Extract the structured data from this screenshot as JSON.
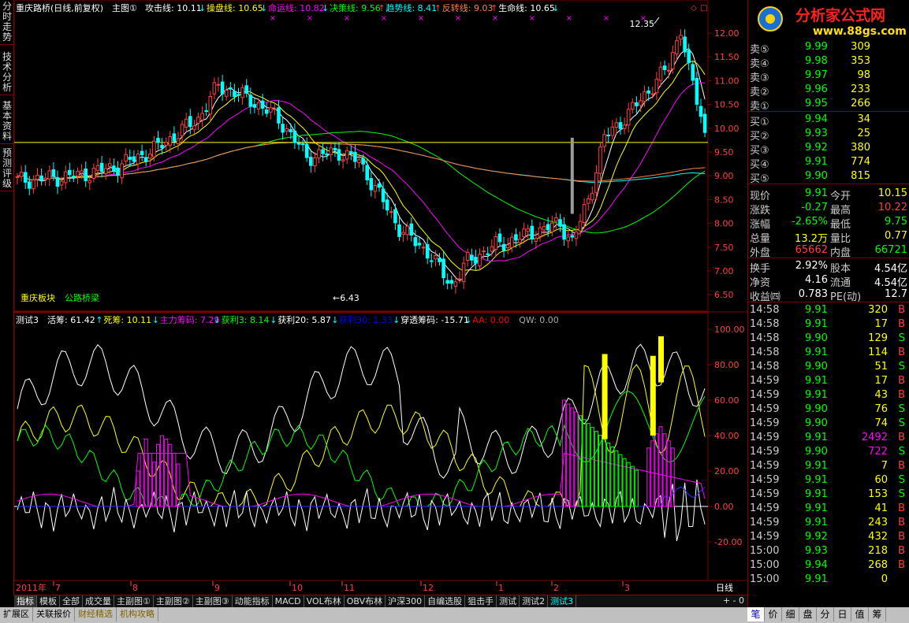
{
  "left_tabs": [
    "分时走势",
    "技术分析",
    "基本资料",
    "预测评级"
  ],
  "main_header": {
    "stock": "重庆路桥(日线,前复权)",
    "main_fig": "主图①",
    "lines": [
      {
        "label": "攻击线: 10.11",
        "arrow": "↓",
        "color": "#ffffff"
      },
      {
        "label": "操盘线: 10.65",
        "arrow": "↓",
        "color": "#ffff00"
      },
      {
        "label": "命运线: 10.82",
        "arrow": "↓",
        "color": "#ff00ff"
      },
      {
        "label": "决策线: 9.56",
        "arrow": "↑",
        "color": "#00ff00"
      },
      {
        "label": "趋势线: 8.41",
        "arrow": "↑",
        "color": "#00ffff"
      },
      {
        "label": "反转线: 9.03",
        "arrow": "↑",
        "color": "#ff8040"
      },
      {
        "label": "生命线: 10.65",
        "arrow": "↓",
        "color": "#ffffff"
      }
    ]
  },
  "main_annotations": {
    "high": "12.35",
    "low": "6.43",
    "sector": "重庆板块",
    "name": "公路桥梁"
  },
  "price_axis": [
    "12.00",
    "11.50",
    "11.00",
    "10.50",
    "10.00",
    "9.50",
    "9.00",
    "8.50",
    "8.00",
    "7.50",
    "7.00",
    "6.50"
  ],
  "ind_header": {
    "name": "测试3",
    "items": [
      {
        "label": "活筹: 61.42",
        "arrow": "↑",
        "color": "#ffffff"
      },
      {
        "label": "死筹: 10.11",
        "arrow": "↓",
        "color": "#ffff00"
      },
      {
        "label": "主力筹码: 7.29",
        "arrow": "↓",
        "color": "#ff00ff"
      },
      {
        "label": "获利3: 8.14",
        "arrow": "↓",
        "color": "#00ff00"
      },
      {
        "label": "获利20: 5.87",
        "arrow": "↓",
        "color": "#ffffff"
      },
      {
        "label": "获利30: 1.33",
        "arrow": "↓",
        "color": "#0000ff"
      },
      {
        "label": "穿透筹码: -15.71",
        "arrow": "↓",
        "color": "#ffffff"
      },
      {
        "label": "AA: 0.00",
        "arrow": "",
        "color": "#ff0000"
      },
      {
        "label": "QW: 0.00",
        "arrow": "",
        "color": "#aaaaaa"
      }
    ]
  },
  "ind_axis": [
    "100.00",
    "80.00",
    "60.00",
    "40.00",
    "20.00",
    "0.00",
    "-20.00"
  ],
  "date_axis": {
    "year": "2011年",
    "months": [
      "7",
      "8",
      "9",
      "10",
      "11",
      "12",
      "1",
      "2",
      "3"
    ],
    "period": "日线"
  },
  "bottom_tabs": [
    "指标",
    "模板",
    "全部",
    "成交量",
    "主副图①",
    "主副图②",
    "主副图③",
    "动能指标",
    "MACD",
    "VOL布林",
    "OBV布林",
    "沪深300",
    "自编选股",
    "狙击手",
    "测试",
    "测试2",
    "测试3"
  ],
  "status_items": [
    "扩展区",
    "关联报价",
    "财经精选",
    "机构攻略"
  ],
  "logo": {
    "text": "分析家公式网",
    "url": "www.88gs.com"
  },
  "order_book": {
    "sell": [
      {
        "label": "卖⑤",
        "price": "9.99",
        "vol": "309"
      },
      {
        "label": "卖④",
        "price": "9.98",
        "vol": "353"
      },
      {
        "label": "卖③",
        "price": "9.97",
        "vol": "98"
      },
      {
        "label": "卖②",
        "price": "9.96",
        "vol": "233"
      },
      {
        "label": "卖①",
        "price": "9.95",
        "vol": "266"
      }
    ],
    "buy": [
      {
        "label": "买①",
        "price": "9.94",
        "vol": "34"
      },
      {
        "label": "买②",
        "price": "9.93",
        "vol": "25"
      },
      {
        "label": "买③",
        "price": "9.92",
        "vol": "380"
      },
      {
        "label": "买④",
        "price": "9.91",
        "vol": "774"
      },
      {
        "label": "买⑤",
        "price": "9.90",
        "vol": "815"
      }
    ]
  },
  "quote": [
    [
      {
        "t": "现价",
        "c": "#ccc"
      },
      {
        "t": "9.91",
        "c": "#00ff00"
      },
      {
        "t": "今开",
        "c": "#ccc"
      },
      {
        "t": "10.15",
        "c": "#ffff00"
      }
    ],
    [
      {
        "t": "涨跌",
        "c": "#ccc"
      },
      {
        "t": "-0.27",
        "c": "#00ff00"
      },
      {
        "t": "最高",
        "c": "#ccc"
      },
      {
        "t": "10.22",
        "c": "#ff4040"
      }
    ],
    [
      {
        "t": "涨幅",
        "c": "#ccc"
      },
      {
        "t": "-2.65%",
        "c": "#00ff00"
      },
      {
        "t": "最低",
        "c": "#ccc"
      },
      {
        "t": "9.75",
        "c": "#00ff00"
      }
    ],
    [
      {
        "t": "总量",
        "c": "#ccc"
      },
      {
        "t": "13.2万",
        "c": "#ffff00"
      },
      {
        "t": "量比",
        "c": "#ccc"
      },
      {
        "t": "0.77",
        "c": "#ffff00"
      }
    ],
    [
      {
        "t": "外盘",
        "c": "#ccc"
      },
      {
        "t": "65662",
        "c": "#ff4040"
      },
      {
        "t": "内盘",
        "c": "#ccc"
      },
      {
        "t": "66721",
        "c": "#00ff00"
      }
    ],
    [
      {
        "t": "换手",
        "c": "#ccc"
      },
      {
        "t": "2.92%",
        "c": "#ffffff"
      },
      {
        "t": "股本",
        "c": "#ccc"
      },
      {
        "t": "4.54亿",
        "c": "#ffffff"
      }
    ],
    [
      {
        "t": "净资",
        "c": "#ccc"
      },
      {
        "t": "4.16",
        "c": "#ffffff"
      },
      {
        "t": "流通",
        "c": "#ccc"
      },
      {
        "t": "4.54亿",
        "c": "#ffffff"
      }
    ],
    [
      {
        "t": "收益㈣",
        "c": "#ccc"
      },
      {
        "t": "0.783",
        "c": "#ffffff"
      },
      {
        "t": "PE(动)",
        "c": "#ccc"
      },
      {
        "t": "12.7",
        "c": "#ffffff"
      }
    ]
  ],
  "ticks": [
    {
      "time": "14:58",
      "price": "9.91",
      "vol": "320",
      "bs": "B"
    },
    {
      "time": "14:58",
      "price": "9.91",
      "vol": "17",
      "bs": "B"
    },
    {
      "time": "14:58",
      "price": "9.90",
      "vol": "129",
      "bs": "S"
    },
    {
      "time": "14:58",
      "price": "9.91",
      "vol": "114",
      "bs": "B"
    },
    {
      "time": "14:58",
      "price": "9.90",
      "vol": "51",
      "bs": "S"
    },
    {
      "time": "14:59",
      "price": "9.91",
      "vol": "17",
      "bs": "B"
    },
    {
      "time": "14:59",
      "price": "9.91",
      "vol": "43",
      "bs": "B"
    },
    {
      "time": "14:59",
      "price": "9.90",
      "vol": "76",
      "bs": "S"
    },
    {
      "time": "14:59",
      "price": "9.90",
      "vol": "74",
      "bs": "S"
    },
    {
      "time": "14:59",
      "price": "9.91",
      "vol": "2492",
      "bs": "B"
    },
    {
      "time": "14:59",
      "price": "9.90",
      "vol": "722",
      "bs": "S"
    },
    {
      "time": "14:59",
      "price": "9.91",
      "vol": "7",
      "bs": "B"
    },
    {
      "time": "14:59",
      "price": "9.91",
      "vol": "60",
      "bs": "S"
    },
    {
      "time": "14:59",
      "price": "9.91",
      "vol": "153",
      "bs": "S"
    },
    {
      "time": "14:59",
      "price": "9.91",
      "vol": "41",
      "bs": "B"
    },
    {
      "time": "14:59",
      "price": "9.91",
      "vol": "243",
      "bs": "B"
    },
    {
      "time": "14:59",
      "price": "9.92",
      "vol": "432",
      "bs": "B"
    },
    {
      "time": "15:00",
      "price": "9.93",
      "vol": "218",
      "bs": "B"
    },
    {
      "time": "15:00",
      "price": "9.94",
      "vol": "268",
      "bs": "B"
    },
    {
      "time": "15:00",
      "price": "9.91",
      "vol": "0",
      "bs": ""
    }
  ],
  "right_tabs": [
    "笔",
    "价",
    "细",
    "盘",
    "分",
    "日",
    "值",
    "筹"
  ],
  "colors": {
    "up": "#ff4040",
    "down": "#00ffff",
    "frame": "#800000",
    "yellow": "#ffff00",
    "green": "#00ff00"
  }
}
